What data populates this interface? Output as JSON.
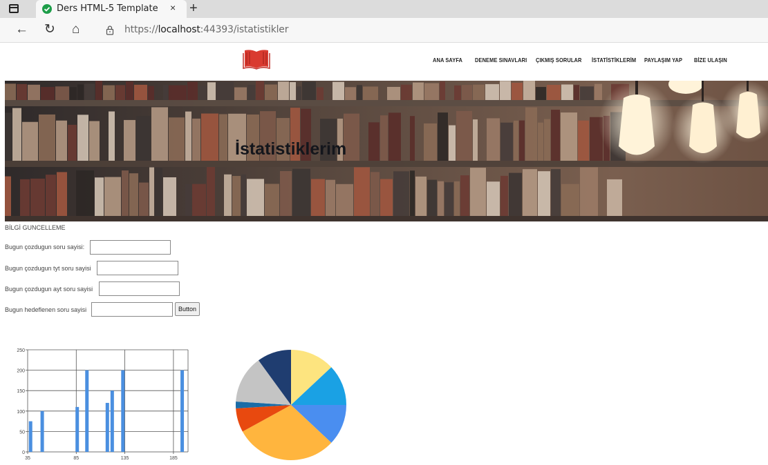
{
  "browser": {
    "tab_title": "Ders HTML-5 Template",
    "tab_close": "×",
    "new_tab": "+",
    "url_prefix": "https://",
    "url_host": "localhost",
    "url_rest": ":44393/istatistikler",
    "back_icon": "←",
    "reload_icon": "↻",
    "home_icon": "⌂"
  },
  "nav": {
    "items": [
      {
        "label": "ANA SAYFA"
      },
      {
        "label": "DENEME SINAVLARI"
      },
      {
        "label": "ÇIKMIŞ SORULAR"
      },
      {
        "label": "İSTATİSTİKLERİM"
      },
      {
        "label": "PAYLAŞIM YAP"
      },
      {
        "label": "BİZE ULAŞIN"
      }
    ],
    "logo_color": "#d93a30"
  },
  "hero": {
    "title": "İstatistiklerim"
  },
  "form": {
    "heading": "BİLGİ GUNCELLEME",
    "fields": [
      {
        "label": "Bugun çozdugun soru sayisi:",
        "value": ""
      },
      {
        "label": "Bugun çozdugun tyt soru sayisi",
        "value": ""
      },
      {
        "label": "Bugun çozdugun ayt soru sayisi",
        "value": ""
      },
      {
        "label": "Bugun hedeflenen soru sayisi",
        "value": ""
      }
    ],
    "button_label": "Button"
  },
  "chart_data": [
    {
      "type": "bar",
      "x": [
        38,
        50,
        86,
        96,
        117,
        122,
        133,
        194
      ],
      "values": [
        75,
        100,
        110,
        200,
        120,
        150,
        200,
        200
      ],
      "xlim": [
        35,
        200
      ],
      "ylim": [
        0,
        250
      ],
      "xticks": [
        "35",
        "85",
        "135",
        "185"
      ],
      "yticks": [
        "0",
        "50",
        "100",
        "150",
        "200",
        "250"
      ],
      "color": "#4a8fe0",
      "grid": true
    },
    {
      "type": "pie",
      "values": [
        13,
        12,
        12,
        30,
        7,
        2,
        14,
        10
      ],
      "colors": [
        "#fde47f",
        "#1aa1e4",
        "#4a8ef0",
        "#ffb53e",
        "#e8490f",
        "#1a6ca7",
        "#c4c4c4",
        "#1f3d70"
      ]
    }
  ]
}
